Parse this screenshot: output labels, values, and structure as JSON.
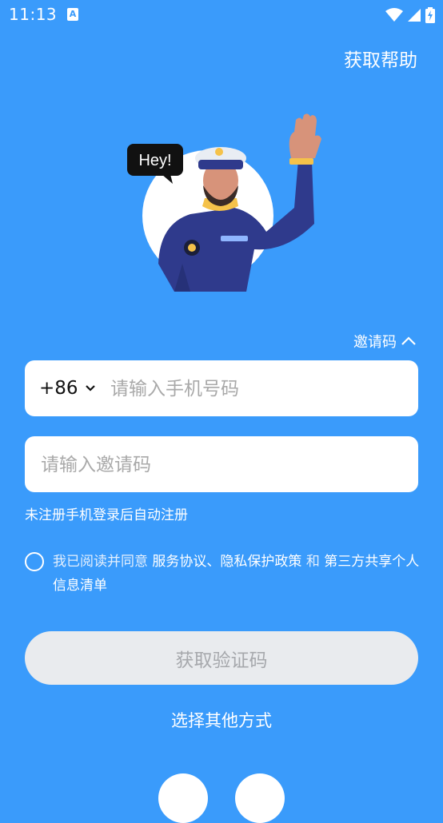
{
  "status_bar": {
    "time": "11:13",
    "app_icon_glyph": "A"
  },
  "header": {
    "help_label": "获取帮助"
  },
  "illustration": {
    "speech_text": "Hey!"
  },
  "invite_toggle": {
    "label": "邀请码"
  },
  "phone_field": {
    "country_code": "+86",
    "placeholder": "请输入手机号码"
  },
  "invite_field": {
    "placeholder": "请输入邀请码"
  },
  "hint": "未注册手机登录后自动注册",
  "agreement": {
    "prefix": "我已阅读并同意",
    "service_link": "服务协议",
    "separator": "、",
    "privacy_link": "隐私保护政策",
    "and": "和",
    "third_party_link": "第三方共享个人信息清单"
  },
  "submit_label": "获取验证码",
  "other_methods_label": "选择其他方式",
  "colors": {
    "background": "#3a9bfb",
    "button_disabled": "#e9ebee"
  }
}
